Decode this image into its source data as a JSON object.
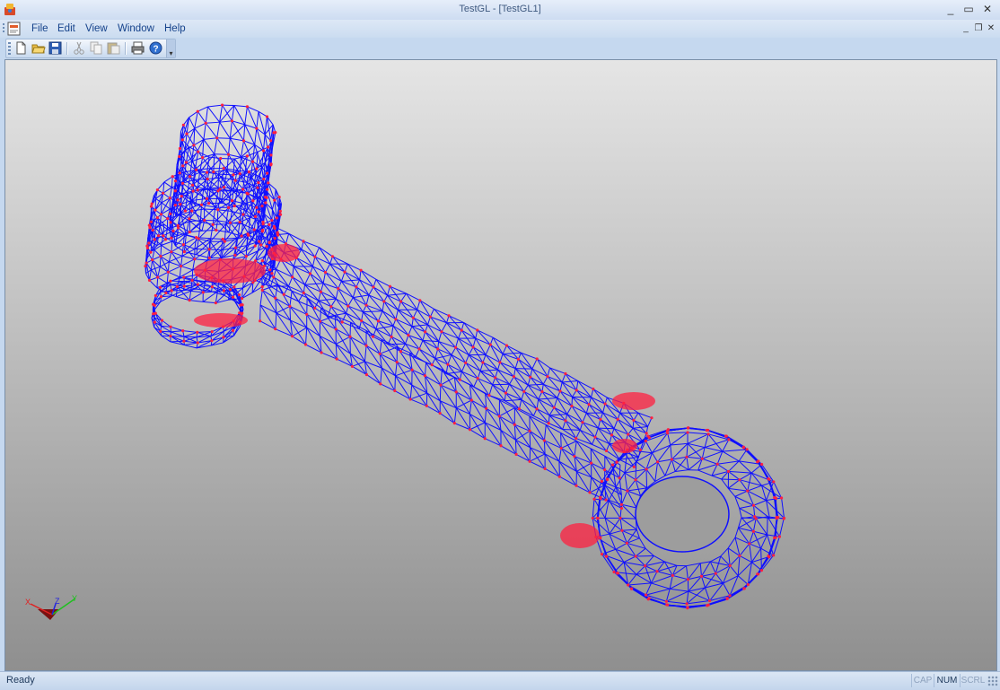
{
  "window": {
    "title": "TestGL - [TestGL1]",
    "minimize": "_",
    "maximize": "▭",
    "close": "✕"
  },
  "menu": {
    "items": [
      {
        "label": "File"
      },
      {
        "label": "Edit"
      },
      {
        "label": "View"
      },
      {
        "label": "Window"
      },
      {
        "label": "Help"
      }
    ],
    "mdi_minimize": "_",
    "mdi_restore": "❐",
    "mdi_close": "✕"
  },
  "toolbar": {
    "buttons": [
      "new-icon",
      "open-icon",
      "save-icon",
      "cut-icon",
      "copy-icon",
      "paste-icon",
      "print-icon",
      "help-icon"
    ]
  },
  "axes": {
    "x": "X",
    "y": "Y",
    "z": "Z",
    "x_color": "#e02020",
    "y_color": "#20c020",
    "z_color": "#2020e0"
  },
  "mesh": {
    "edge_color": "#1010ff",
    "node_color": "#ff2040"
  },
  "status": {
    "text": "Ready",
    "cap": "CAP",
    "num": "NUM",
    "scrl": "SCRL"
  }
}
